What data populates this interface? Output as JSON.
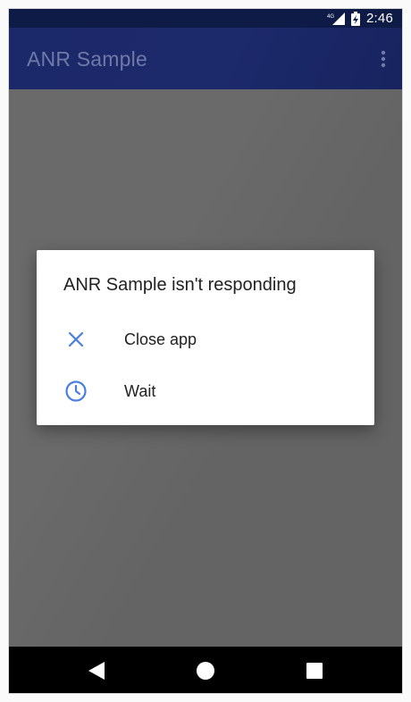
{
  "status_bar": {
    "time": "2:46",
    "icons": [
      "signal-icon",
      "battery-charging-icon"
    ]
  },
  "app_bar": {
    "title": "ANR Sample",
    "overflow_icon": "more-vert-icon"
  },
  "dialog": {
    "title": "ANR Sample isn't responding",
    "options": [
      {
        "label": "Close app",
        "icon": "close-icon"
      },
      {
        "label": "Wait",
        "icon": "clock-icon"
      }
    ]
  },
  "nav_bar": {
    "icons": [
      "back-icon",
      "home-icon",
      "recents-icon"
    ]
  },
  "colors": {
    "status_bar": "#0f1b47",
    "app_bar": "#1b2869",
    "scrim": "#666666",
    "accent": "#4a7fe0",
    "nav_bar": "#000000"
  }
}
